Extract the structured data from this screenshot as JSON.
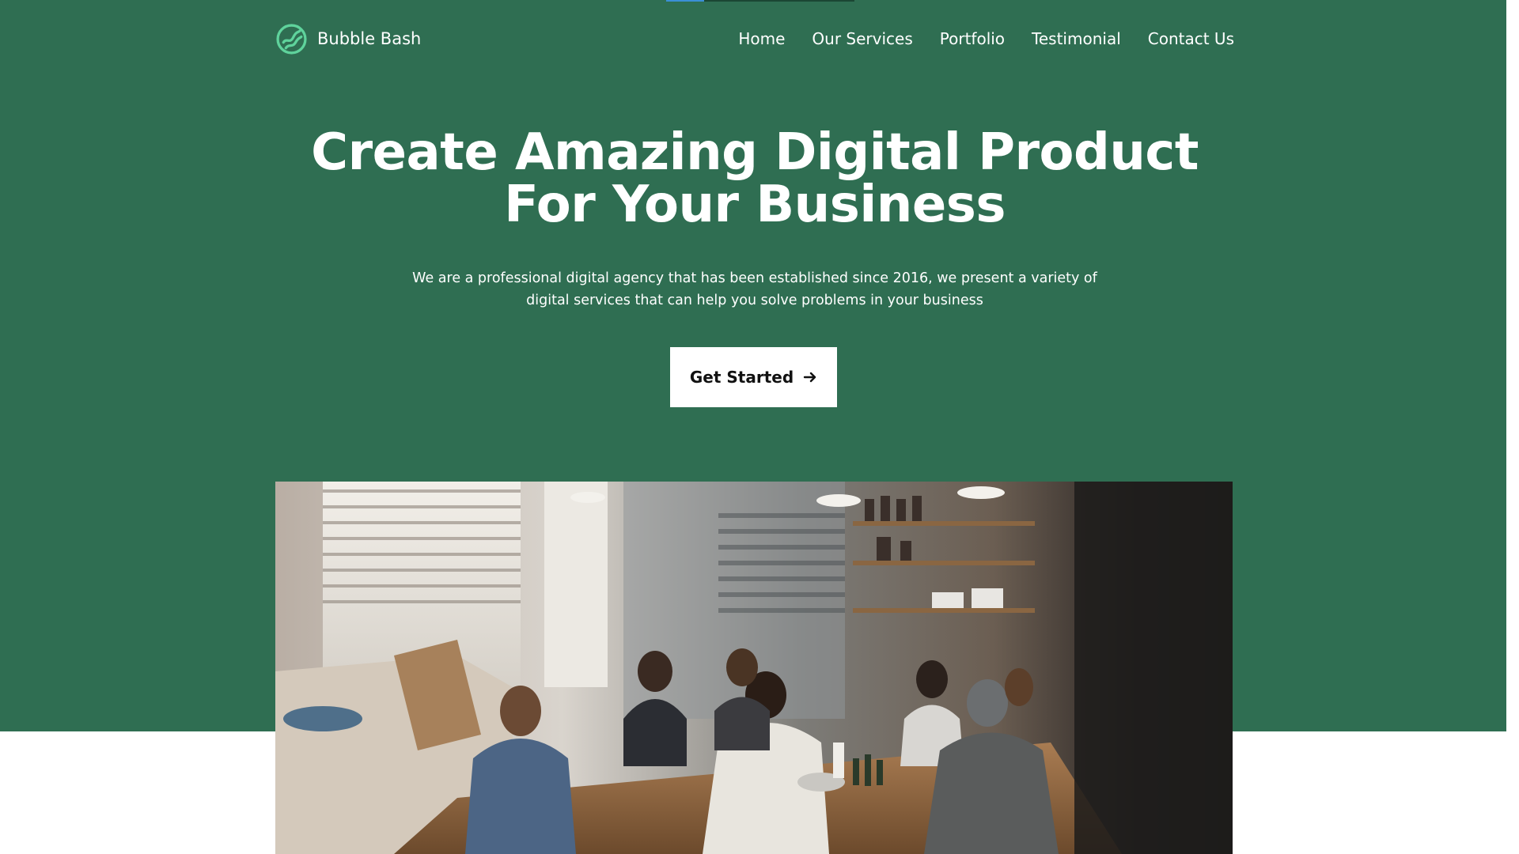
{
  "brand": {
    "name": "Bubble Bash",
    "logo_icon": "brand-logo-icon",
    "accent": "#5fd39c"
  },
  "nav": {
    "items": [
      {
        "label": "Home"
      },
      {
        "label": "Our Services"
      },
      {
        "label": "Portfolio"
      },
      {
        "label": "Testimonial"
      },
      {
        "label": "Contact Us"
      }
    ]
  },
  "hero": {
    "title_line1": "Create Amazing Digital Product",
    "title_line2": "For Your Business",
    "description": "We are a professional digital agency that has been established since 2016, we present a variety of digital services that can help you solve problems in your business",
    "cta_label": "Get Started",
    "cta_icon": "arrow-right-icon",
    "image_subject": "team-meeting-photo"
  },
  "colors": {
    "hero_background": "#2f6e52",
    "page_background": "#ffffff",
    "cta_background": "#ffffff",
    "cta_text": "#111111"
  },
  "page_progress": {
    "value": 0.2
  }
}
